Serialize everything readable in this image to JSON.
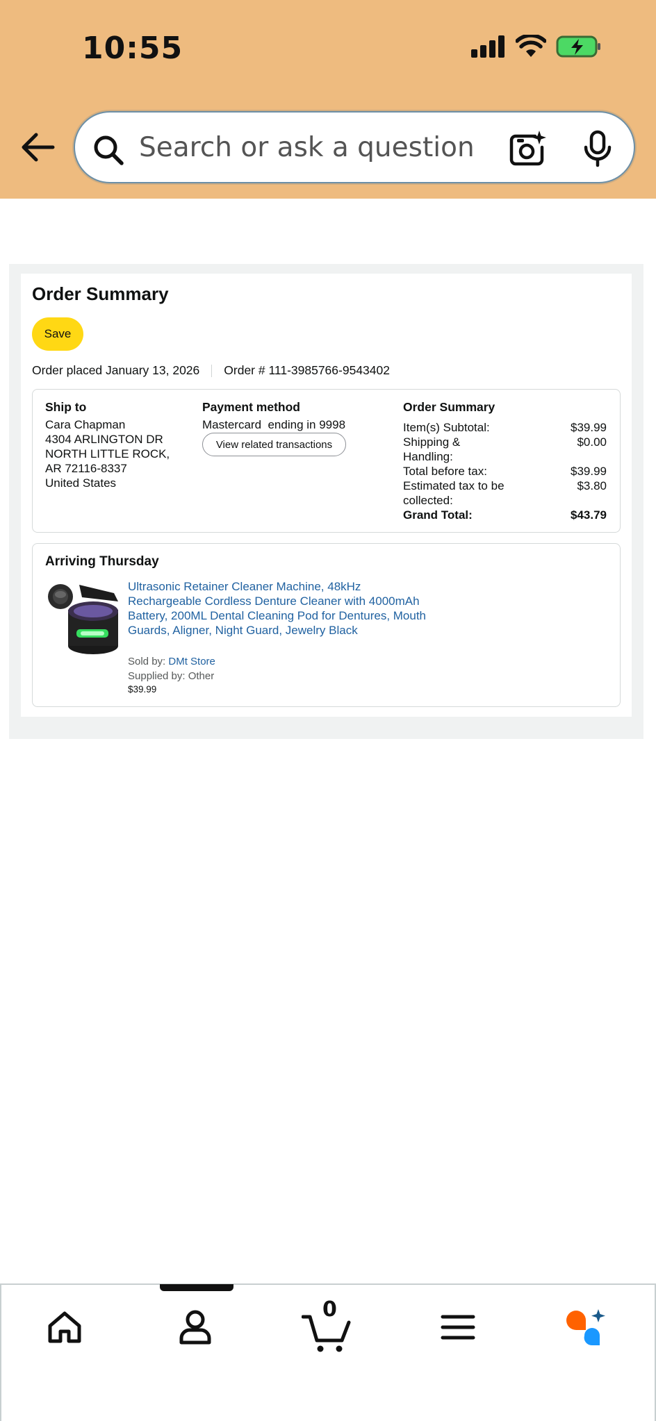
{
  "status_bar": {
    "time": "10:55"
  },
  "search": {
    "placeholder": "Search or ask a question"
  },
  "order": {
    "title": "Order Summary",
    "save_label": "Save",
    "placed_label": "Order placed January 13, 2026",
    "order_number": "Order # 111-3985766-9543402"
  },
  "ship_to": {
    "heading": "Ship to",
    "lines": [
      "Cara Chapman",
      "4304 ARLINGTON DR",
      "NORTH LITTLE ROCK,",
      "AR 72116-8337",
      "United States"
    ]
  },
  "payment": {
    "heading": "Payment method",
    "card_text": "Mastercard  ending in 9998",
    "transactions_button": "View related transactions"
  },
  "summary": {
    "heading": "Order Summary",
    "rows": [
      {
        "label": "Item(s) Subtotal:",
        "value": "$39.99"
      },
      {
        "label": "Shipping & Handling:",
        "value": "$0.00"
      },
      {
        "label": "Total before tax:",
        "value": "$39.99"
      },
      {
        "label": "Estimated tax to be collected:",
        "value": "$3.80"
      }
    ],
    "grand_total_label": "Grand Total:",
    "grand_total_value": "$43.79"
  },
  "shipment": {
    "heading": "Arriving Thursday",
    "product_title": "Ultrasonic Retainer Cleaner Machine, 48kHz Rechargeable Cordless Denture Cleaner with 4000mAh Battery, 200ML Dental Cleaning Pod for Dentures, Mouth Guards, Aligner, Night Guard, Jewelry Black",
    "sold_by_label": "Sold by: ",
    "seller": "DMt Store",
    "supplied_by": "Supplied by: Other",
    "price": "$39.99"
  },
  "bottom_nav": {
    "cart_count": "0",
    "items": [
      "home-icon",
      "account-icon",
      "cart-icon",
      "menu-icon",
      "rufus-icon"
    ]
  },
  "colors": {
    "header_bg": "#eebb7f",
    "save_button": "#ffd814",
    "link": "#2162a1",
    "ai_orange": "#ff6200",
    "ai_blue": "#1a98ff"
  }
}
